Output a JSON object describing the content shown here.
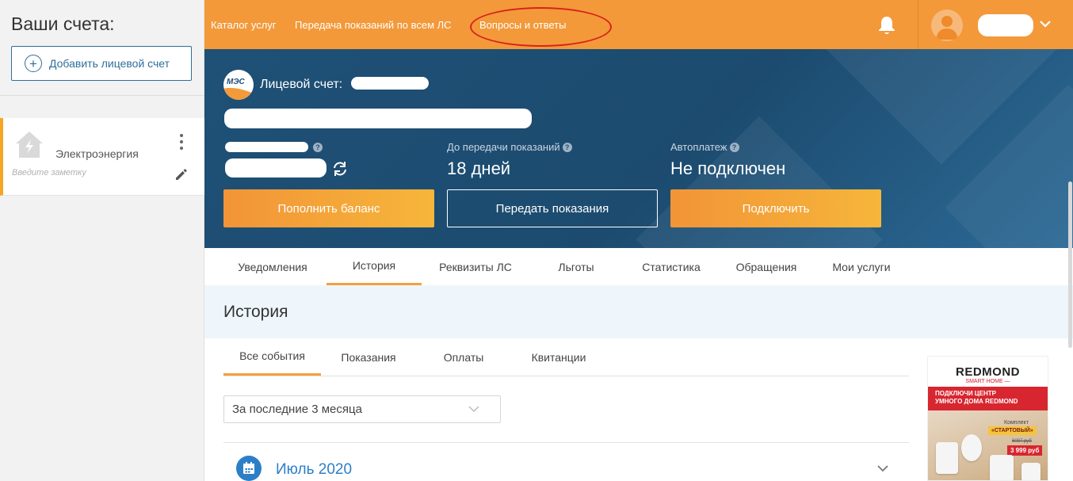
{
  "sidebar": {
    "title": "Ваши счета:",
    "add_button": "Добавить лицевой счет",
    "accounts": [
      {
        "type": "Электроэнергия",
        "note_placeholder": "Введите заметку"
      }
    ]
  },
  "topbar": {
    "links": [
      "Каталог услуг",
      "Передача показаний по всем ЛС",
      "Вопросы и ответы"
    ]
  },
  "hero": {
    "logo_text": "МЭС",
    "account_label": "Лицевой счет:",
    "stats": [
      {
        "label": "До передачи показаний",
        "value": "18 дней"
      },
      {
        "label": "Автоплатеж",
        "value": "Не подключен"
      }
    ],
    "buttons": {
      "top_up": "Пополнить баланс",
      "submit_readings": "Передать показания",
      "connect": "Подключить"
    }
  },
  "tabs": [
    "Уведомления",
    "История",
    "Реквизиты ЛС",
    "Льготы",
    "Статистика",
    "Обращения",
    "Мои услуги"
  ],
  "history": {
    "title": "История",
    "subtabs": [
      "Все события",
      "Показания",
      "Оплаты",
      "Квитанции"
    ],
    "period_select": "За последние 3 месяца",
    "month": "Июль 2020"
  },
  "ad": {
    "brand": "REDMOND",
    "subtitle": "SMART HOME —",
    "headline_1": "ПОДКЛЮЧИ ЦЕНТР",
    "headline_2": "УМНОГО ДОМА REDMOND",
    "kit": "Комплект",
    "kit_name": "«СТАРТОВЫЙ»",
    "old_price": "6097 руб",
    "price": "3 999 руб"
  },
  "colors": {
    "accent_orange": "#f3993a",
    "hero_blue": "#1d4f78",
    "link_blue": "#2c7fc7",
    "annotation_red": "#d9231c"
  }
}
